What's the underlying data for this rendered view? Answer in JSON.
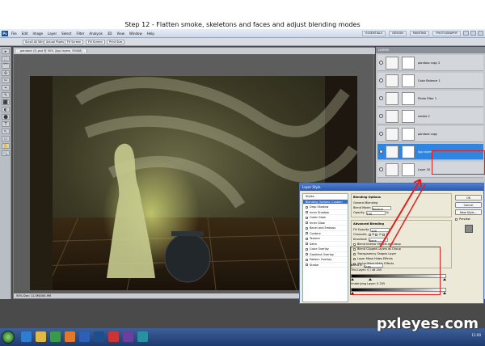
{
  "caption": "Step 12 - Flatten smoke, skeletons and faces and adjust blending modes",
  "app": {
    "logo": "Ps",
    "menu": [
      "File",
      "Edit",
      "Image",
      "Layer",
      "Select",
      "Filter",
      "Analysis",
      "3D",
      "View",
      "Window",
      "Help"
    ],
    "workspace_buttons": [
      "ESSENTIALS",
      "DESIGN",
      "PAINTING",
      "PHOTOGRAPHY"
    ],
    "options_bar": [
      "Scroll All Windows",
      "Actual Pixels",
      "Fit Screen",
      "Fill Screen",
      "Print Size"
    ],
    "tools": [
      "▸",
      "⬚",
      "⌒",
      "✣",
      "✂",
      "⌖",
      "✎",
      "⬛",
      "◐",
      "⬤",
      "T",
      "↖",
      "▭",
      "✋",
      "🔍"
    ],
    "doc_tab": "pandora (3).psd @ 50% (Ayp layers, RGB/8)",
    "status": "50%   Doc: 11.0M/164.9M"
  },
  "layers_panel": {
    "header": "LAYERS",
    "rows": [
      {
        "name": "pandora copy 2",
        "selected": false
      },
      {
        "name": "Color Balance 1",
        "selected": false
      },
      {
        "name": "Photo Filter 1",
        "selected": false
      },
      {
        "name": "smoke 2",
        "selected": false
      },
      {
        "name": "pandora copy",
        "selected": false
      },
      {
        "name": "Ayp layers",
        "selected": true
      },
      {
        "name": "Layer 20",
        "selected": false
      }
    ]
  },
  "layer_style": {
    "title": "Layer Style",
    "styles": [
      {
        "label": "Styles",
        "checkbox": false,
        "active": false
      },
      {
        "label": "Blending Options: Custom",
        "checkbox": false,
        "active": true
      },
      {
        "label": "Drop Shadow",
        "checkbox": true,
        "active": false
      },
      {
        "label": "Inner Shadow",
        "checkbox": true,
        "active": false
      },
      {
        "label": "Outer Glow",
        "checkbox": true,
        "active": false
      },
      {
        "label": "Inner Glow",
        "checkbox": true,
        "active": false
      },
      {
        "label": "Bevel and Emboss",
        "checkbox": true,
        "active": false
      },
      {
        "label": "Contour",
        "checkbox": true,
        "active": false
      },
      {
        "label": "Texture",
        "checkbox": true,
        "active": false
      },
      {
        "label": "Satin",
        "checkbox": true,
        "active": false
      },
      {
        "label": "Color Overlay",
        "checkbox": true,
        "active": false
      },
      {
        "label": "Gradient Overlay",
        "checkbox": true,
        "active": false
      },
      {
        "label": "Pattern Overlay",
        "checkbox": true,
        "active": false
      },
      {
        "label": "Stroke",
        "checkbox": true,
        "active": false
      }
    ],
    "general": {
      "group_title": "Blending Options",
      "sub_title": "General Blending",
      "blend_mode_label": "Blend Mode:",
      "blend_mode_value": "Normal",
      "opacity_label": "Opacity:",
      "opacity_value": "100",
      "opacity_unit": "%"
    },
    "advanced": {
      "title": "Advanced Blending",
      "fill_label": "Fill Opacity:",
      "fill_value": "100",
      "channels_label": "Channels:",
      "channels": [
        "R",
        "G",
        "B"
      ],
      "knockout_label": "Knockout:",
      "knockout_value": "None",
      "options": [
        "Blend Interior Effects as Group",
        "Blend Clipped Layers as Group",
        "Transparency Shapes Layer",
        "Layer Mask Hides Effects",
        "Vector Mask Hides Effects"
      ]
    },
    "blend_if": {
      "label": "Blend If:",
      "value": "Gray",
      "this_layer_label": "This Layer:",
      "this_layer_values": "0  /  46      255",
      "underlying_label": "Underlying Layer:",
      "underlying_values": "0      255"
    },
    "buttons": [
      "OK",
      "Cancel",
      "New Style...",
      "Preview"
    ]
  },
  "taskbar": {
    "clock": "11:00"
  },
  "watermark": "pxleyes.com"
}
